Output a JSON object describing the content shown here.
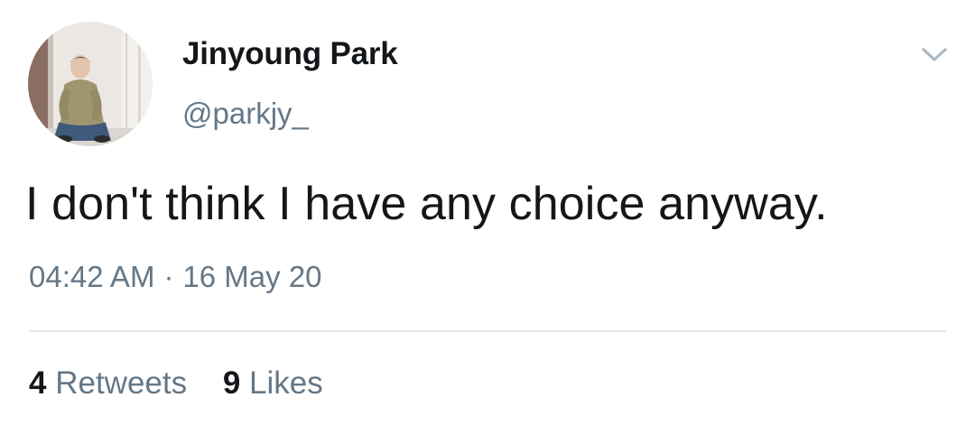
{
  "author": {
    "display_name": "Jinyoung Park",
    "handle": "@parkjy_"
  },
  "tweet": {
    "text": "I don't think I have any choice anyway.",
    "time": "04:42 AM",
    "separator": "·",
    "date": "16 May 20"
  },
  "stats": {
    "retweets_count": "4",
    "retweets_label": "Retweets",
    "likes_count": "9",
    "likes_label": "Likes"
  },
  "icons": {
    "menu": "chevron-down-icon"
  },
  "colors": {
    "text_primary": "#14171a",
    "text_secondary": "#657786",
    "divider": "#e1e8ed",
    "caret": "#aab8c2"
  }
}
